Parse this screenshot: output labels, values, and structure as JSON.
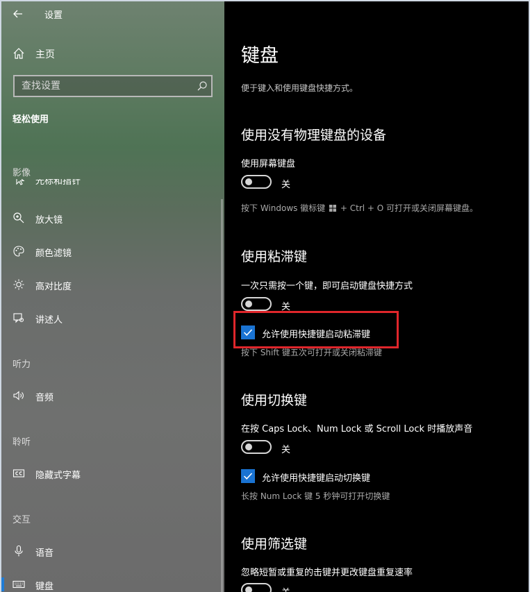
{
  "window": {
    "title": "设置"
  },
  "sidebar": {
    "home_label": "主页",
    "search_placeholder": "查找设置",
    "category": "轻松使用",
    "group_vision": "影像",
    "clipped_item": "光标和指针",
    "items_vision": [
      {
        "label": "放大镜",
        "icon": "magnifier-icon"
      },
      {
        "label": "颜色滤镜",
        "icon": "palette-icon"
      },
      {
        "label": "高对比度",
        "icon": "brightness-icon"
      },
      {
        "label": "讲述人",
        "icon": "narrator-icon"
      }
    ],
    "group_hearing": "听力",
    "items_hearing": [
      {
        "label": "音频",
        "icon": "speaker-icon"
      }
    ],
    "group_listen": "聆听",
    "items_listen": [
      {
        "label": "隐藏式字幕",
        "icon": "closed-captions-icon"
      }
    ],
    "group_interaction": "交互",
    "items_interaction": [
      {
        "label": "语音",
        "icon": "microphone-icon"
      },
      {
        "label": "键盘",
        "icon": "keyboard-icon",
        "selected": true
      }
    ]
  },
  "main": {
    "title": "键盘",
    "description": "便于键入和使用键盘快捷方式。",
    "section_osk": {
      "title": "使用没有物理键盘的设备",
      "setting_label": "使用屏幕键盘",
      "toggle_state": "关",
      "hint_pre": "按下 Windows 徽标键",
      "hint_post": "+ Ctrl + O 可打开或关闭屏幕键盘。"
    },
    "section_sticky": {
      "title": "使用粘滞键",
      "setting_label": "一次只需按一个键，即可启动键盘快捷方式",
      "toggle_state": "关",
      "checkbox_label": "允许使用快捷键启动粘滞键",
      "hint": "按下 Shift 键五次可打开或关闭粘滞键"
    },
    "section_toggle": {
      "title": "使用切换键",
      "setting_label": "在按 Caps Lock、Num Lock 或 Scroll Lock 时播放声音",
      "toggle_state": "关",
      "checkbox_label": "允许使用快捷键启动切换键",
      "hint": "长按 Num Lock 键 5 秒钟可打开切换键"
    },
    "section_filter": {
      "title": "使用筛选键",
      "setting_label": "忽略短暂或重复的击键并更改键盘重复速率",
      "toggle_state": "关"
    }
  },
  "colors": {
    "accent": "#1a73d2",
    "highlight": "#e0262b"
  }
}
